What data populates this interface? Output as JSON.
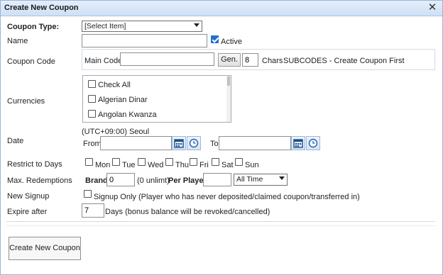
{
  "dialog": {
    "title": "Create New Coupon",
    "close_glyph": "✕"
  },
  "coupon_type": {
    "label": "Coupon Type:",
    "selected": "[Select Item]"
  },
  "name": {
    "label": "Name",
    "value": "",
    "active_label": "Active",
    "active_checked": true
  },
  "coupon_code": {
    "label": "Coupon Code",
    "main_code_label": "Main Code:",
    "main_code_value": "",
    "gen_label": "Gen.",
    "chars_value": "8",
    "chars_label": "Chars",
    "subcodes_text": "SUBCODES - Create Coupon First"
  },
  "currencies": {
    "label": "Currencies",
    "items": [
      {
        "label": "Check All",
        "checked": false
      },
      {
        "label": "Algerian Dinar",
        "checked": false
      },
      {
        "label": "Angolan Kwanza",
        "checked": false
      }
    ]
  },
  "date": {
    "label": "Date",
    "timezone": "(UTC+09:00) Seoul",
    "from_label": "From",
    "from_value": "",
    "to_label": "To",
    "to_value": ""
  },
  "restrict_days": {
    "label": "Restrict to Days",
    "days": [
      "Mon",
      "Tue",
      "Wed",
      "Thu",
      "Fri",
      "Sat",
      "Sun"
    ]
  },
  "max_redemptions": {
    "label": "Max. Redemptions",
    "brand_label": "Brand:",
    "brand_value": "0",
    "unlimited_note": "(0 unlimt)",
    "per_player_label": "Per Player:",
    "per_player_value": "",
    "period_selected": "All Time"
  },
  "new_signup": {
    "label": "New Signup",
    "option_label": "Signup Only (Player who has never deposited/claimed coupon/transferred in)",
    "checked": false
  },
  "expire_after": {
    "label": "Expire after",
    "value": "7",
    "note": "Days (bonus balance will be revoked/cancelled)"
  },
  "footer": {
    "create_button": "Create New Coupon"
  },
  "colors": {
    "title_bar": "#d9e7f8",
    "check_accent": "#1f6fd6"
  }
}
